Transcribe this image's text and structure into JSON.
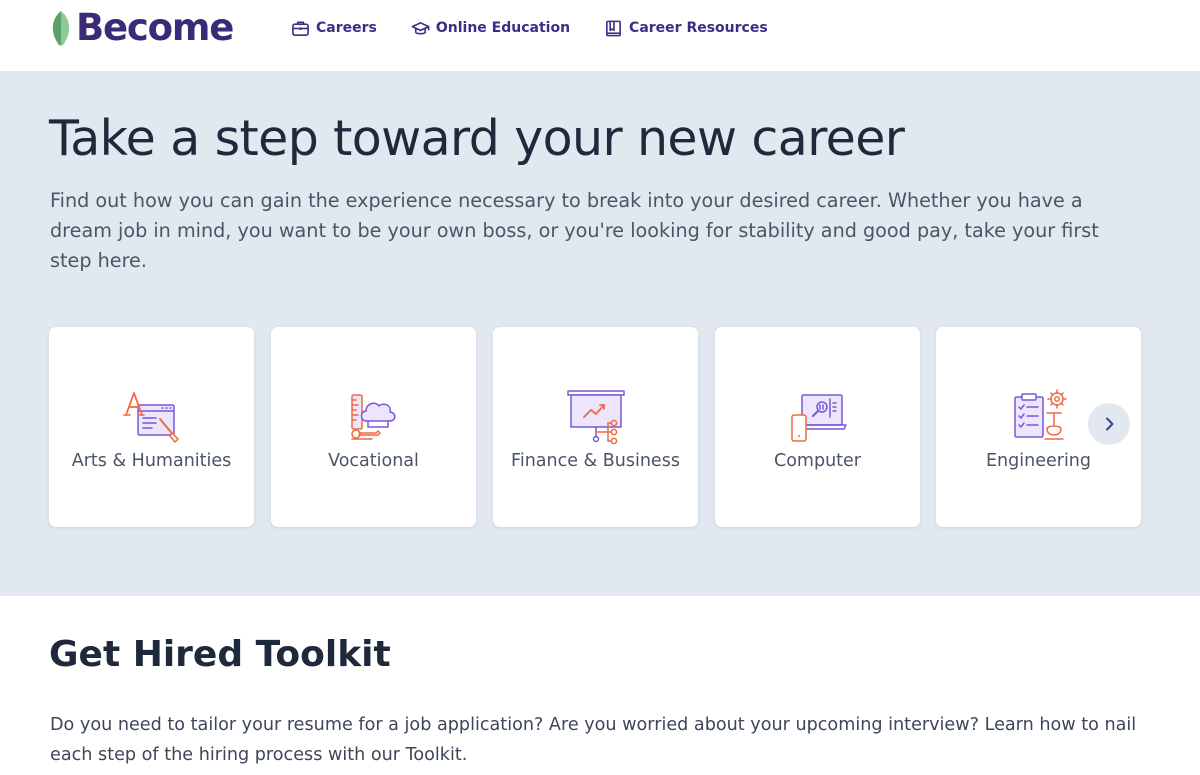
{
  "brand": {
    "name": "Become",
    "colors": {
      "primary": "#3b2a78",
      "nav": "#3a2f86",
      "leaf": "#5aa06a",
      "icon_purple": "#7b56d9",
      "icon_orange": "#ee6a45",
      "hero_bg": "#e2e8ef"
    }
  },
  "nav": [
    {
      "label": "Careers",
      "icon": "briefcase-icon"
    },
    {
      "label": "Online Education",
      "icon": "graduation-cap-icon"
    },
    {
      "label": "Career Resources",
      "icon": "book-icon"
    }
  ],
  "hero": {
    "title": "Take a step toward your new career",
    "description": "Find out how you can gain the experience necessary to break into your desired career. Whether you have a dream job in mind, you want to be your own boss, or you're looking for stability and good pay, take your first step here."
  },
  "categories": [
    {
      "label": "Arts & Humanities",
      "icon": "arts-humanities-icon"
    },
    {
      "label": "Vocational",
      "icon": "vocational-icon"
    },
    {
      "label": "Finance & Business",
      "icon": "finance-business-icon"
    },
    {
      "label": "Computer",
      "icon": "computer-icon"
    },
    {
      "label": "Engineering",
      "icon": "engineering-icon"
    }
  ],
  "carousel": {
    "next_icon": "chevron-right-icon"
  },
  "toolkit": {
    "title": "Get Hired Toolkit",
    "description": "Do you need to tailor your resume for a job application? Are you worried about your upcoming interview? Learn how to nail each step of the hiring process with our Toolkit."
  }
}
